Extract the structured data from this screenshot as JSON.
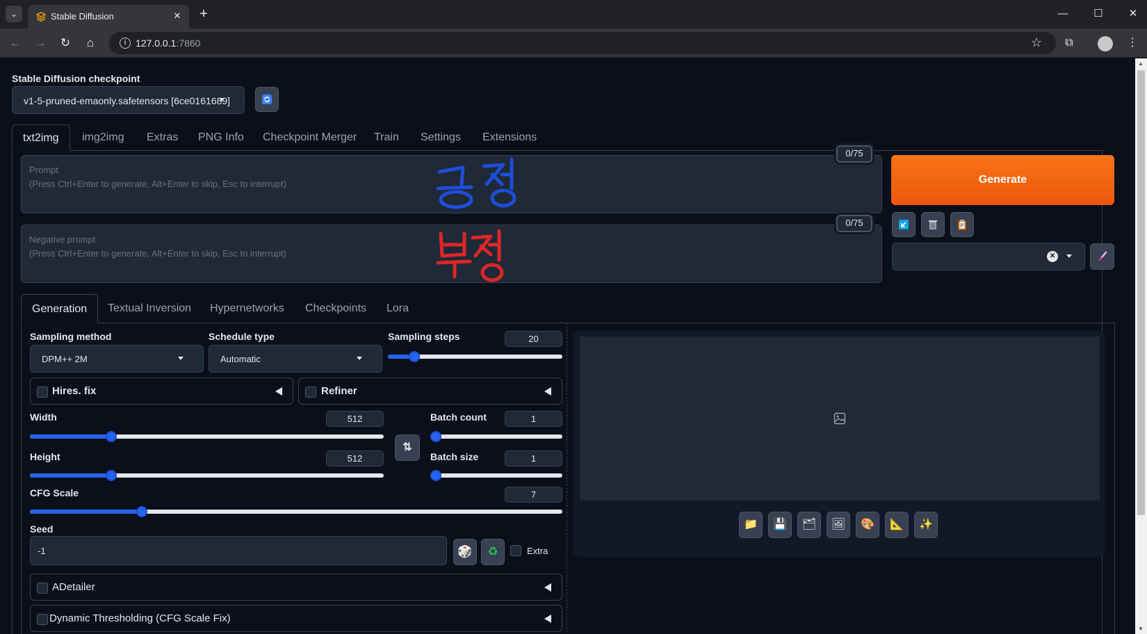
{
  "browser": {
    "tab_title": "Stable Diffusion",
    "url_host": "127.0.0.1",
    "url_port": ":7860"
  },
  "checkpoint": {
    "label": "Stable Diffusion checkpoint",
    "value": "v1-5-pruned-emaonly.safetensors [6ce0161689]"
  },
  "main_tabs": [
    "txt2img",
    "img2img",
    "Extras",
    "PNG Info",
    "Checkpoint Merger",
    "Train",
    "Settings",
    "Extensions"
  ],
  "prompt": {
    "placeholder_line1": "Prompt",
    "placeholder_line2": "(Press Ctrl+Enter to generate, Alt+Enter to skip, Esc to interrupt)",
    "token_count": "0/75",
    "annotation": "긍정"
  },
  "negative_prompt": {
    "placeholder_line1": "Negative prompt",
    "placeholder_line2": "(Press Ctrl+Enter to generate, Alt+Enter to skip, Esc to interrupt)",
    "token_count": "0/75",
    "annotation": "부정"
  },
  "generate_label": "Generate",
  "styles_clear_symbol": "✕",
  "sub_tabs": [
    "Generation",
    "Textual Inversion",
    "Hypernetworks",
    "Checkpoints",
    "Lora"
  ],
  "sampling": {
    "method_label": "Sampling method",
    "method_value": "DPM++ 2M",
    "schedule_label": "Schedule type",
    "schedule_value": "Automatic",
    "steps_label": "Sampling steps",
    "steps_value": "20",
    "steps_fraction": 0.15
  },
  "hires_fix_label": "Hires. fix",
  "refiner_label": "Refiner",
  "width": {
    "label": "Width",
    "value": "512",
    "fraction": 0.23
  },
  "height": {
    "label": "Height",
    "value": "512",
    "fraction": 0.23
  },
  "batch_count": {
    "label": "Batch count",
    "value": "1",
    "fraction": 0.0
  },
  "batch_size": {
    "label": "Batch size",
    "value": "1",
    "fraction": 0.0
  },
  "cfg_scale": {
    "label": "CFG Scale",
    "value": "7",
    "fraction": 0.21
  },
  "seed": {
    "label": "Seed",
    "value": "-1",
    "extra_label": "Extra"
  },
  "adetailer_label": "ADetailer",
  "dynamic_threshold_label": "Dynamic Thresholding (CFG Scale Fix)",
  "colors": {
    "accent": "#2563eb",
    "generate": "#f97316",
    "background": "#0b0f19"
  },
  "icons": {
    "refresh": "refresh-icon",
    "paste": "arrow-icon",
    "trash": "trash-icon",
    "clipboard": "clipboard-icon",
    "brush": "brush-icon",
    "swap": "swap-icon",
    "dice": "dice-icon",
    "recycle": "recycle-icon",
    "image_placeholder": "image-icon",
    "folder": "folder-icon",
    "save": "save-icon",
    "zip": "zip-icon",
    "send_img2img": "picture-icon",
    "send_inpaint": "palette-icon",
    "send_extras": "ruler-icon",
    "upscale": "sparkle-icon"
  }
}
